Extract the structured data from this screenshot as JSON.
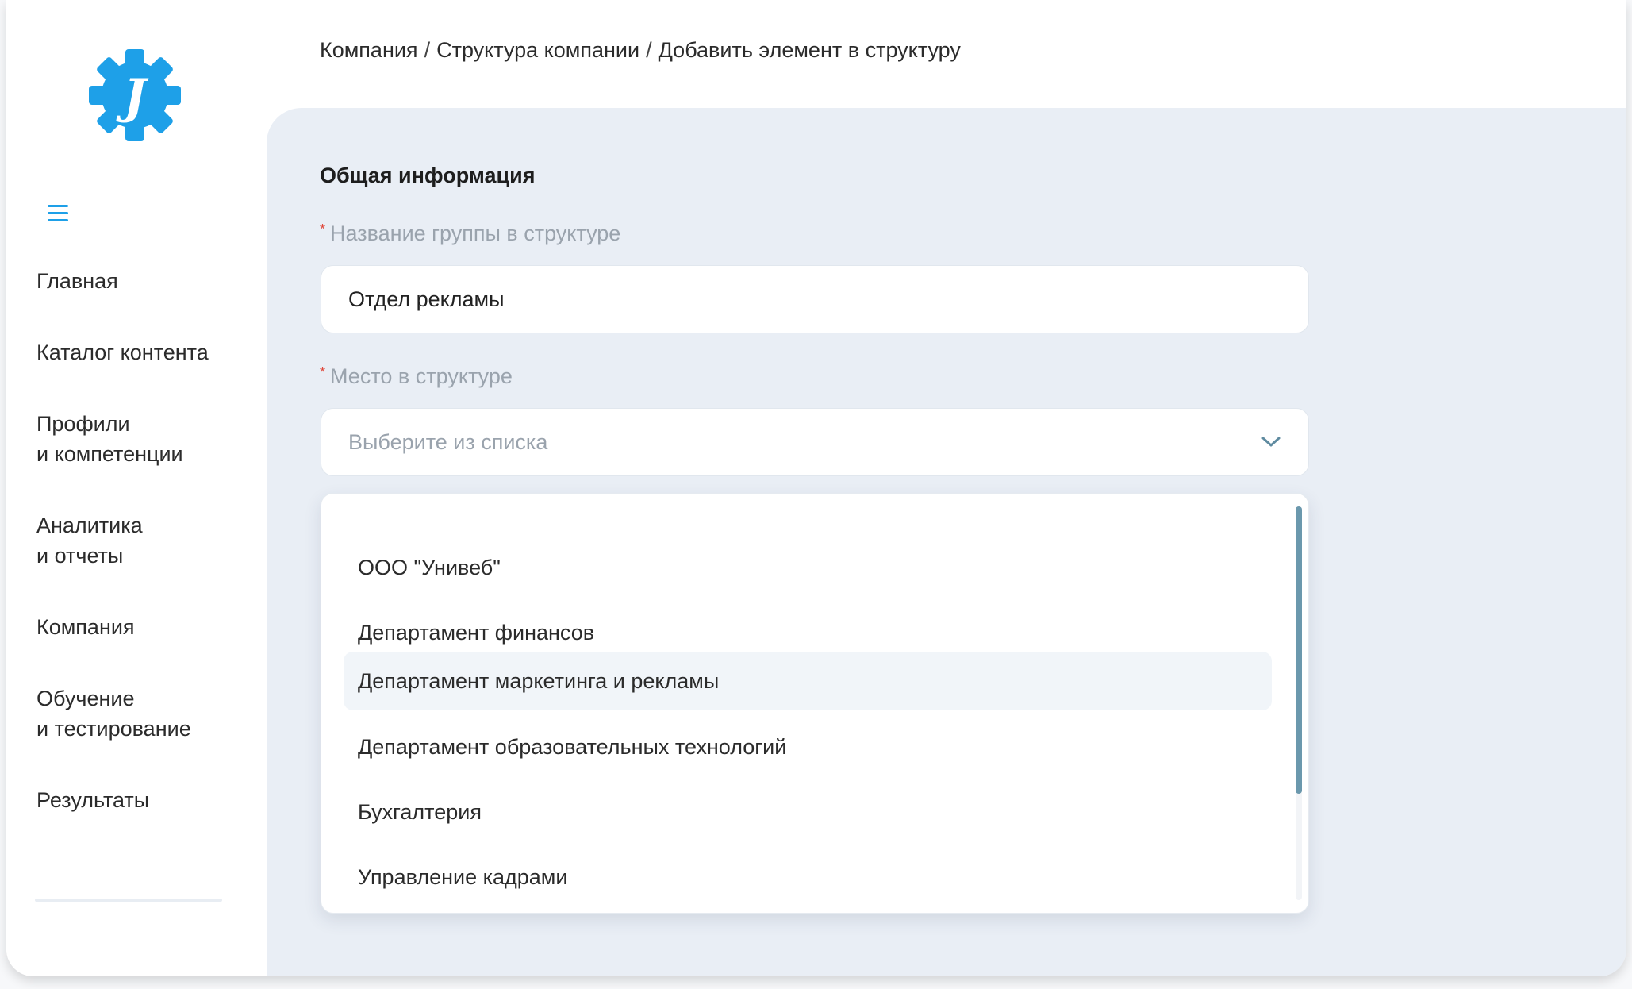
{
  "breadcrumb": {
    "items": [
      "Компания",
      "Структура компании",
      "Добавить элемент в структуру"
    ],
    "separator": "/"
  },
  "sidebar": {
    "logo_letter": "J",
    "logo_color": "#1ea0e8",
    "items": [
      {
        "label": "Главная"
      },
      {
        "label": "Каталог контента"
      },
      {
        "label": "Профили\nи компетенции"
      },
      {
        "label": "Аналитика\nи отчеты"
      },
      {
        "label": "Компания"
      },
      {
        "label": "Обучение\nи тестирование"
      },
      {
        "label": "Результаты"
      }
    ]
  },
  "form": {
    "section_title": "Общая информация",
    "group_name": {
      "label": "Название группы в структуре",
      "required_mark": "*",
      "value": "Отдел рекламы"
    },
    "place": {
      "label": "Место в структуре",
      "required_mark": "*",
      "placeholder": "Выберите из списка"
    }
  },
  "dropdown": {
    "options": [
      "ООО \"Унивеб\"",
      "Департамент финансов",
      "Департамент маркетинга и рекламы",
      "Департамент образовательных технологий",
      "Бухгалтерия",
      "Управление кадрами"
    ],
    "hovered_index": 2
  },
  "colors": {
    "accent": "#1ea0e8",
    "panel_bg": "#e9eef5",
    "scroll_thumb": "#6b98ad",
    "required": "#e0483b"
  }
}
